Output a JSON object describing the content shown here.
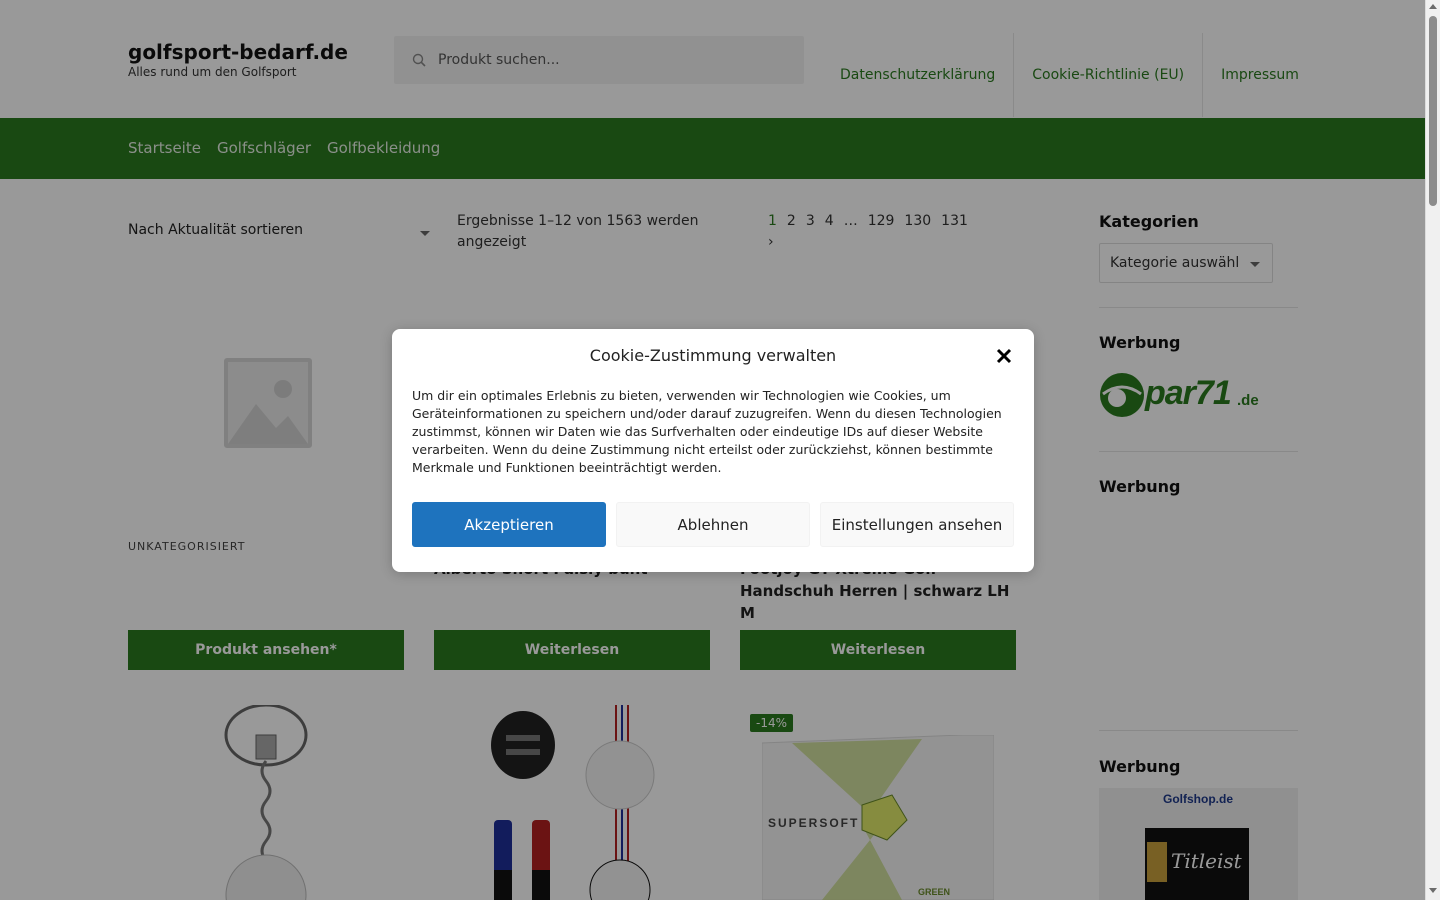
{
  "header": {
    "site_title": "golfsport-bedarf.de",
    "tagline": "Alles rund um den Golfsport",
    "search_placeholder": "Produkt suchen...",
    "links": [
      "Datenschutzerklärung",
      "Cookie-Richtlinie (EU)",
      "Impressum"
    ]
  },
  "nav": {
    "items": [
      "Startseite",
      "Golfschläger",
      "Golfbekleidung"
    ]
  },
  "toolbar": {
    "sort_label": "Nach Aktualität sortieren",
    "result_count": "Ergebnisse 1–12 von 1563 werden angezeigt",
    "pages": [
      "1",
      "2",
      "3",
      "4",
      "…",
      "129",
      "130",
      "131"
    ],
    "current_page": "1",
    "next_symbol": "›"
  },
  "products": [
    {
      "category": "UNKATEGORISIERT",
      "title": "",
      "button": "Produkt ansehen*"
    },
    {
      "category": "",
      "title": "Alberto Short Paisly bunt",
      "button": "Weiterlesen"
    },
    {
      "category": "",
      "title": "Footjoy GT Xtreme Golf Handschuh Herren | schwarz LH M",
      "button": "Weiterlesen"
    }
  ],
  "product_row2": {
    "sale_badge": "-14%"
  },
  "sidebar": {
    "categories_title": "Kategorien",
    "category_select": "Kategorie auswähl",
    "ad_title_1": "Werbung",
    "ad_logo_par71_main": "par71",
    "ad_logo_par71_tld": ".de",
    "ad_title_2": "Werbung",
    "ad_title_3": "Werbung",
    "ad_golfshop": "Golfshop.de"
  },
  "cookie_modal": {
    "title": "Cookie-Zustimmung verwalten",
    "text": "Um dir ein optimales Erlebnis zu bieten, verwenden wir Technologien wie Cookies, um Geräteinformationen zu speichern und/oder darauf zuzugreifen. Wenn du diesen Technologien zustimmst, können wir Daten wie das Surfverhalten oder eindeutige IDs auf dieser Website verarbeiten. Wenn du deine Zustimmung nicht erteilst oder zurückziehst, können bestimmte Merkmale und Funktionen beeinträchtigt werden.",
    "accept": "Akzeptieren",
    "deny": "Ablehnen",
    "settings": "Einstellungen ansehen"
  },
  "colors": {
    "brand_green": "#2a7a1f",
    "accept_blue": "#1e73be"
  }
}
